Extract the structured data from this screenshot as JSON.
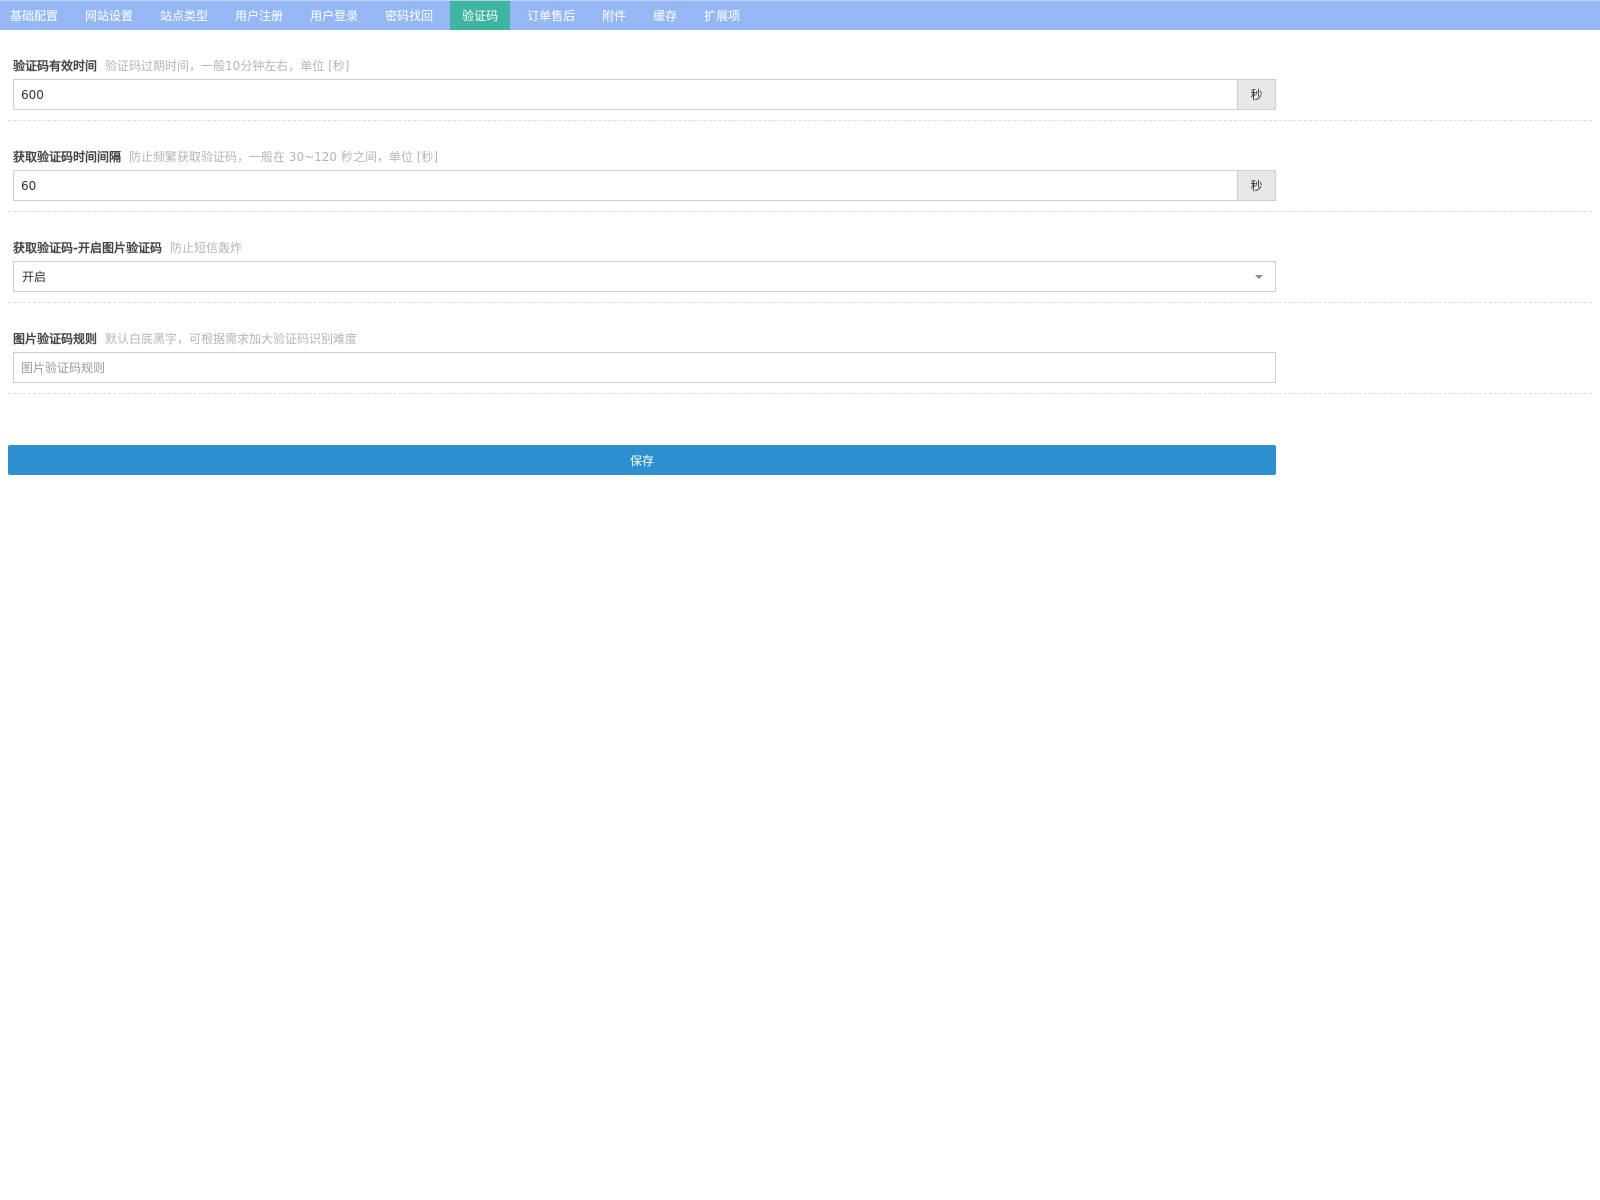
{
  "tabs": [
    {
      "label": "基础配置",
      "active": false
    },
    {
      "label": "网站设置",
      "active": false
    },
    {
      "label": "站点类型",
      "active": false
    },
    {
      "label": "用户注册",
      "active": false
    },
    {
      "label": "用户登录",
      "active": false
    },
    {
      "label": "密码找回",
      "active": false
    },
    {
      "label": "验证码",
      "active": true
    },
    {
      "label": "订单售后",
      "active": false
    },
    {
      "label": "附件",
      "active": false
    },
    {
      "label": "缓存",
      "active": false
    },
    {
      "label": "扩展项",
      "active": false
    }
  ],
  "fields": {
    "code_expire": {
      "title": "验证码有效时间",
      "hint": "验证码过期时间，一般10分钟左右，单位 [秒]",
      "value": "600",
      "unit": "秒"
    },
    "code_interval": {
      "title": "获取验证码时间间隔",
      "hint": "防止频繁获取验证码，一般在 30~120 秒之间，单位 [秒]",
      "value": "60",
      "unit": "秒"
    },
    "image_captcha": {
      "title": "获取验证码-开启图片验证码",
      "hint": "防止短信轰炸",
      "selected": "开启"
    },
    "image_rule": {
      "title": "图片验证码规则",
      "hint": "默认白底黑字，可根据需求加大验证码识别难度",
      "placeholder": "图片验证码规则",
      "value": ""
    }
  },
  "save_label": "保存",
  "colors": {
    "tabbar_bg": "#95b8f5",
    "tab_active_bg": "#3eb5a0",
    "save_button_bg": "#2d8fd0"
  }
}
